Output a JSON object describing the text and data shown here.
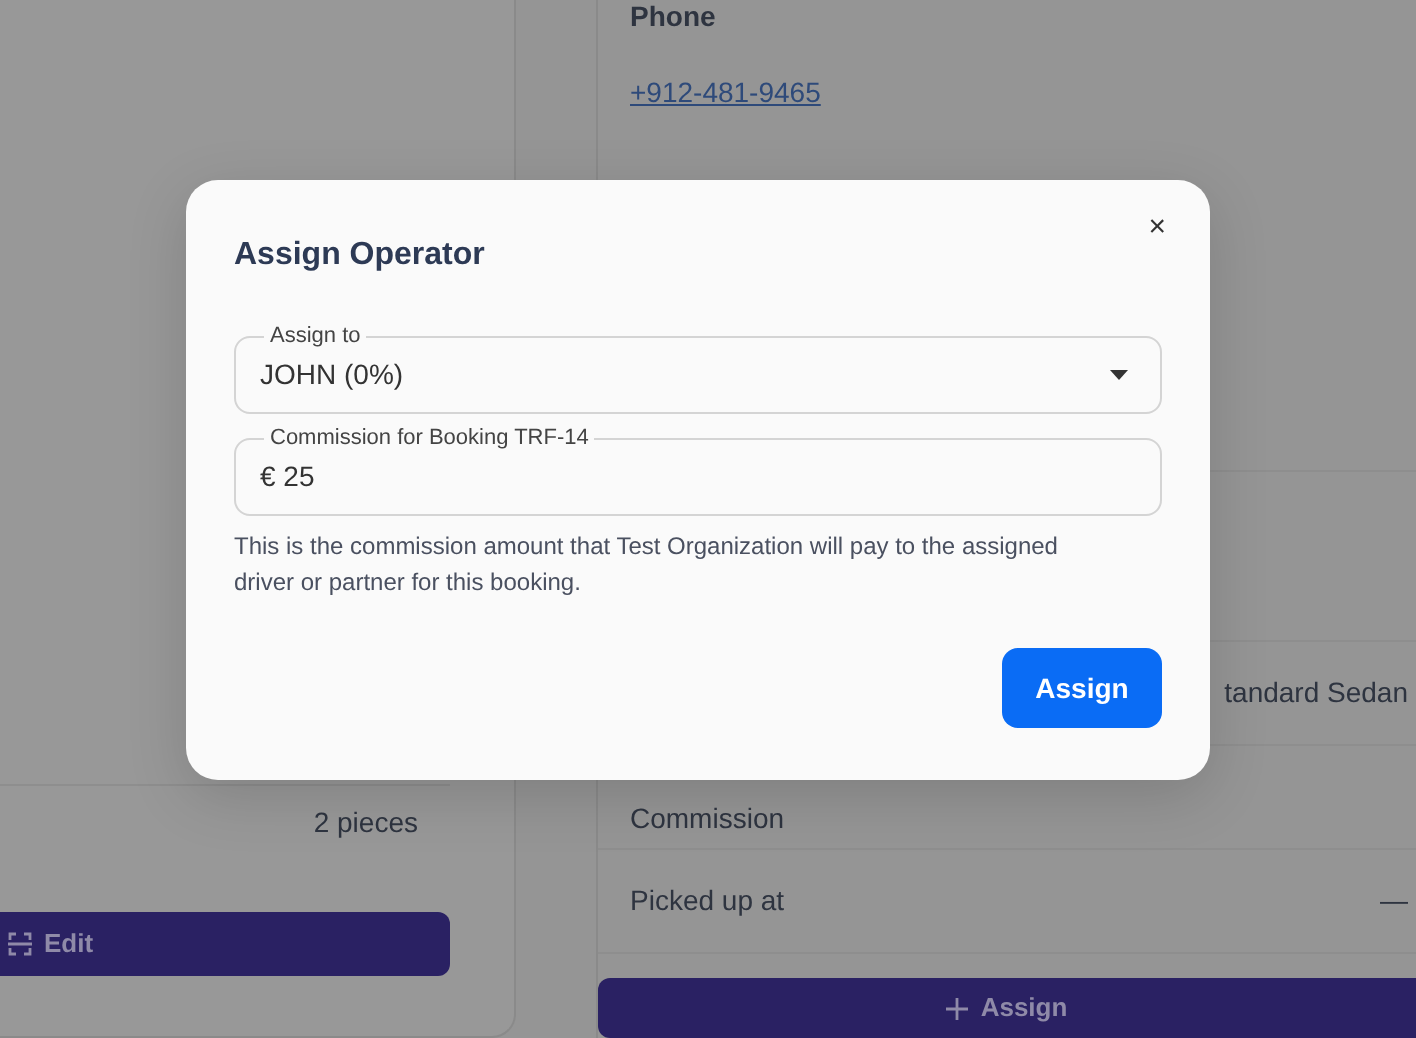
{
  "background": {
    "contact": {
      "label": "Phone",
      "phone": "+912-481-9465"
    },
    "left_card": {
      "value": "2 pieces",
      "button": "Edit"
    },
    "details": [
      {
        "kind": "value",
        "text": "tandard Sedan"
      },
      {
        "kind": "label",
        "text": "Commission"
      },
      {
        "kind": "pair",
        "text": "Picked up at",
        "value": "—"
      }
    ],
    "assign_button": "Assign"
  },
  "modal": {
    "title": "Assign Operator",
    "close": "×",
    "assign_to": {
      "label": "Assign to",
      "value": "JOHN (0%)"
    },
    "commission": {
      "label": "Commission for Booking TRF-14",
      "value": "€ 25"
    },
    "help": "This is the commission amount that Test Organization will pay to the assigned driver or partner for this booking.",
    "submit": "Assign"
  }
}
